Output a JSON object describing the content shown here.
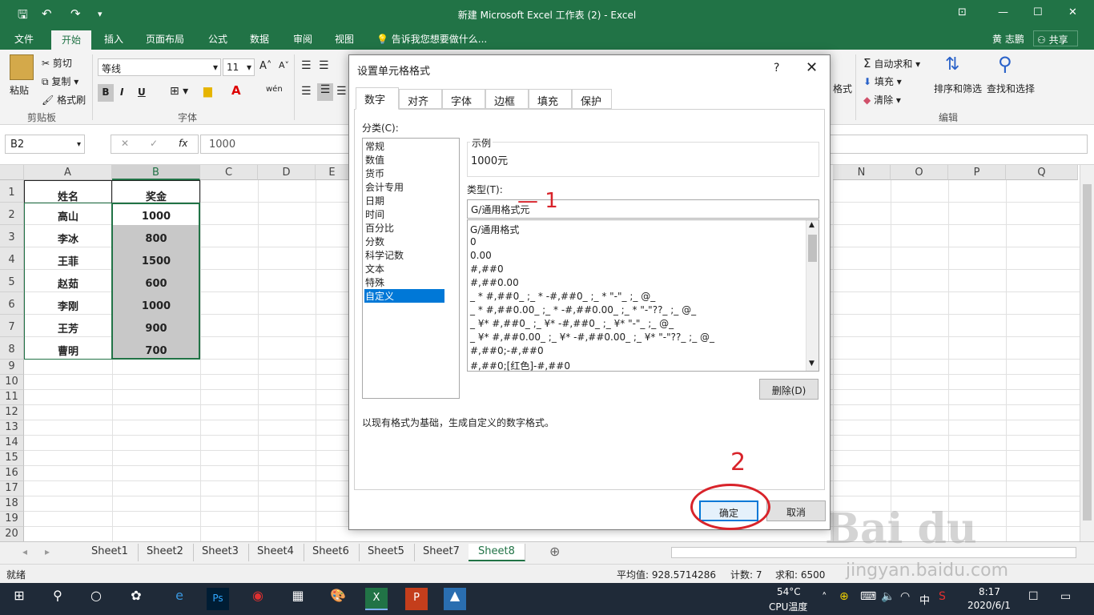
{
  "window": {
    "title": "新建 Microsoft Excel 工作表 (2) - Excel",
    "min": "—",
    "max": "☐",
    "close": "✕"
  },
  "menu": {
    "tabs": [
      "文件",
      "开始",
      "插入",
      "页面布局",
      "公式",
      "数据",
      "审阅",
      "视图"
    ],
    "tell_me": "告诉我您想要做什么...",
    "user": "黄 志鹏",
    "share": "共享"
  },
  "ribbon": {
    "paste": "粘贴",
    "cut": "剪切",
    "copy": "复制",
    "format_painter": "格式刷",
    "clipboard": "剪贴板",
    "font_name": "等线",
    "font_size": "11",
    "font_group": "字体",
    "bold": "B",
    "italic": "I",
    "underline": "U",
    "autosum": "自动求和",
    "fill": "填充",
    "clear": "清除",
    "sort_filter": "排序和筛选",
    "find_select": "查找和选择",
    "editing": "编辑",
    "style_fragment": "格式"
  },
  "formula_bar": {
    "name_box": "B2",
    "cancel": "✕",
    "enter": "✓",
    "fx": "fx",
    "value": "1000"
  },
  "grid": {
    "columns_left": [
      "A",
      "B",
      "C",
      "D",
      "E"
    ],
    "columns_right": [
      "N",
      "O",
      "P",
      "Q"
    ],
    "rows": [
      "1",
      "2",
      "3",
      "4",
      "5",
      "6",
      "7",
      "8",
      "9",
      "10",
      "11",
      "12",
      "13",
      "14",
      "15",
      "16",
      "17",
      "18",
      "19",
      "20"
    ],
    "header": {
      "name": "姓名",
      "bonus": "奖金"
    },
    "data": [
      {
        "name": "高山",
        "bonus": "1000"
      },
      {
        "name": "李冰",
        "bonus": "800"
      },
      {
        "name": "王菲",
        "bonus": "1500"
      },
      {
        "name": "赵茹",
        "bonus": "600"
      },
      {
        "name": "李刚",
        "bonus": "1000"
      },
      {
        "name": "王芳",
        "bonus": "900"
      },
      {
        "name": "曹明",
        "bonus": "700"
      }
    ]
  },
  "sheets": [
    "Sheet1",
    "Sheet2",
    "Sheet3",
    "Sheet4",
    "Sheet6",
    "Sheet5",
    "Sheet7",
    "Sheet8"
  ],
  "active_sheet": "Sheet8",
  "status": {
    "ready": "就绪",
    "average": "平均值: 928.5714286",
    "count": "计数: 7",
    "sum": "求和: 6500"
  },
  "dialog": {
    "title": "设置单元格格式",
    "help": "?",
    "close": "✕",
    "tabs": [
      "数字",
      "对齐",
      "字体",
      "边框",
      "填充",
      "保护"
    ],
    "category_label": "分类(C):",
    "categories": [
      "常规",
      "数值",
      "货币",
      "会计专用",
      "日期",
      "时间",
      "百分比",
      "分数",
      "科学记数",
      "文本",
      "特殊",
      "自定义"
    ],
    "selected_category": "自定义",
    "sample_label": "示例",
    "sample_value": "1000元",
    "type_label": "类型(T):",
    "type_value": "G/通用格式元",
    "formats": [
      "G/通用格式",
      "0",
      "0.00",
      "#,##0",
      "#,##0.00",
      "_ * #,##0_ ;_ * -#,##0_ ;_ * \"-\"_ ;_ @_",
      "_ * #,##0.00_ ;_ * -#,##0.00_ ;_ * \"-\"??_ ;_ @_",
      "_ ¥* #,##0_ ;_ ¥* -#,##0_ ;_ ¥* \"-\"_ ;_ @_",
      "_ ¥* #,##0.00_ ;_ ¥* -#,##0.00_ ;_ ¥* \"-\"??_ ;_ @_",
      "#,##0;-#,##0",
      "#,##0;[红色]-#,##0"
    ],
    "delete": "删除(D)",
    "hint": "以现有格式为基础，生成自定义的数字格式。",
    "ok": "确定",
    "cancel": "取消"
  },
  "annotations": {
    "one": "— 1",
    "two": "2"
  },
  "taskbar": {
    "temp": "54°C",
    "cpu": "CPU温度",
    "ime": "中",
    "time": "8:17",
    "date": "2020/6/1"
  },
  "watermark": "jingyan.baidu.com"
}
